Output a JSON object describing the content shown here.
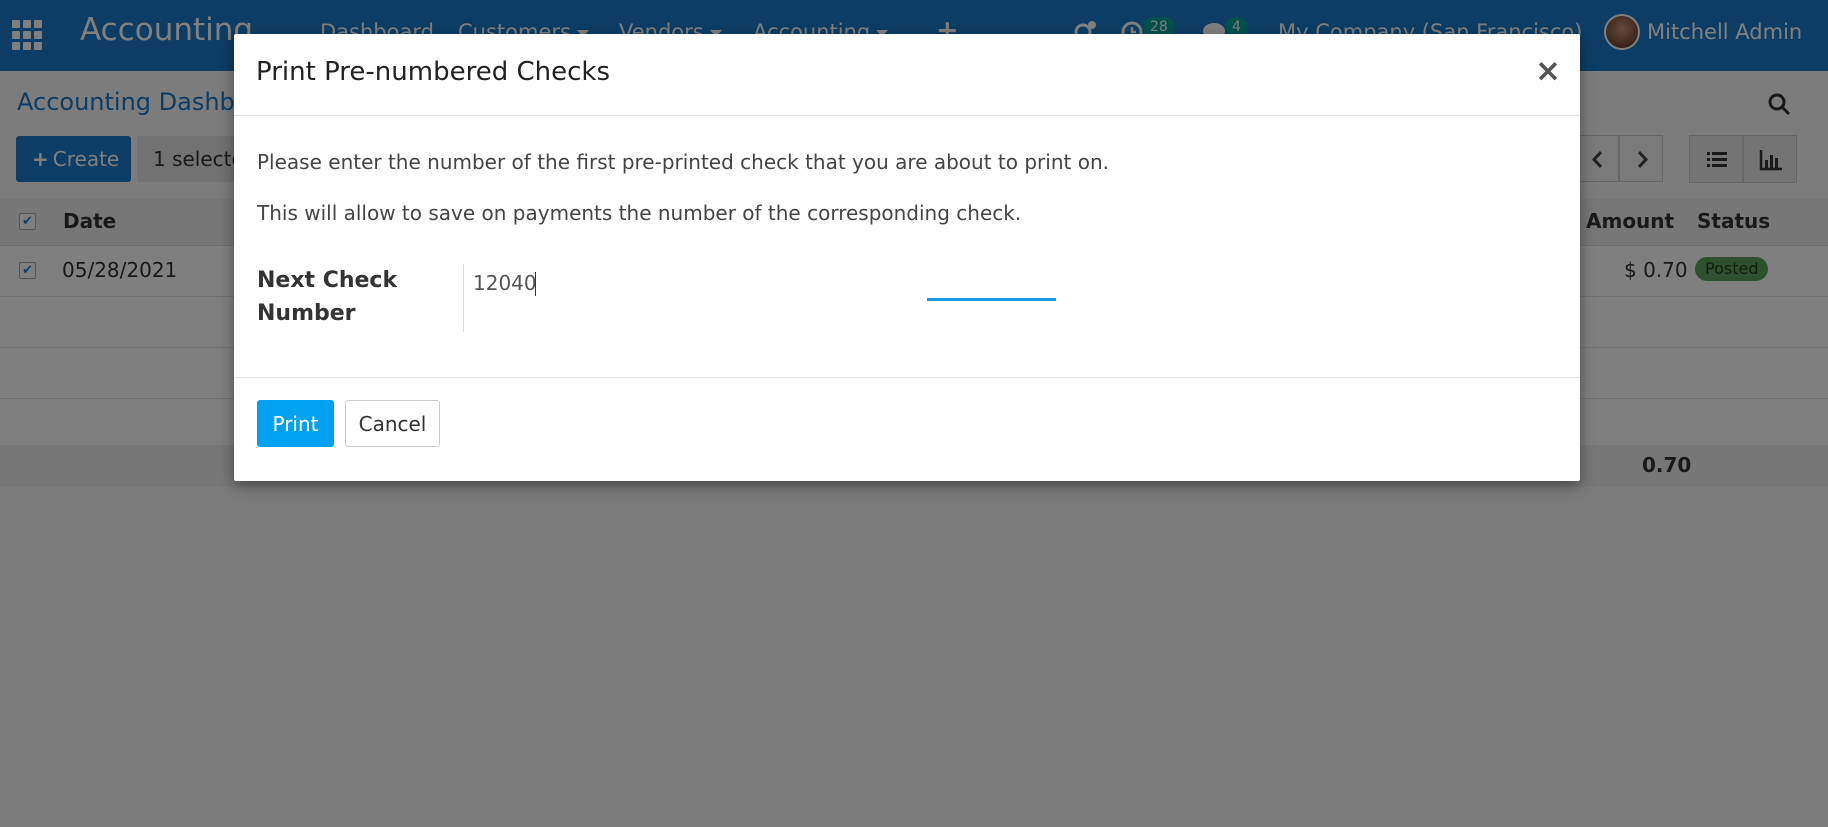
{
  "navbar": {
    "brand": "Accounting",
    "menu": [
      {
        "label": "Dashboard",
        "has_dropdown": false
      },
      {
        "label": "Customers",
        "has_dropdown": true
      },
      {
        "label": "Vendors",
        "has_dropdown": true
      },
      {
        "label": "Accounting",
        "has_dropdown": true
      }
    ],
    "plus_label": "+",
    "activities_icon": "clock-icon",
    "activities_count": "28",
    "messages_icon": "chat-icon",
    "messages_count": "4",
    "company": "My Company (San Francisco)",
    "user_name": "Mitchell Admin",
    "accent_color": "#1a7ac8"
  },
  "control_panel": {
    "breadcrumb": "Accounting Dashbo",
    "create_label": "Create",
    "selected_label": "1 selecte",
    "search_icon": "search-icon",
    "pager_prev_icon": "chevron-left-icon",
    "pager_next_icon": "chevron-right-icon",
    "views": [
      "list-view-icon",
      "graph-view-icon"
    ]
  },
  "table": {
    "headers": {
      "date": "Date",
      "amount": "Amount",
      "status": "Status"
    },
    "rows": [
      {
        "date": "05/28/2021",
        "amount": "$ 0.70",
        "status": "Posted",
        "selected": true
      }
    ],
    "total": "0.70",
    "status_color": "#5ba15b"
  },
  "dialog": {
    "title": "Print Pre-numbered Checks",
    "close_label": "×",
    "line1": "Please enter the number of the first pre-printed check that you are about to print on.",
    "line2": "This will allow to save on payments the number of the corresponding check.",
    "field_label_line1": "Next Check",
    "field_label_line2": "Number",
    "field_value": "12040",
    "print_label": "Print",
    "cancel_label": "Cancel",
    "primary_color": "#00a1f0"
  }
}
